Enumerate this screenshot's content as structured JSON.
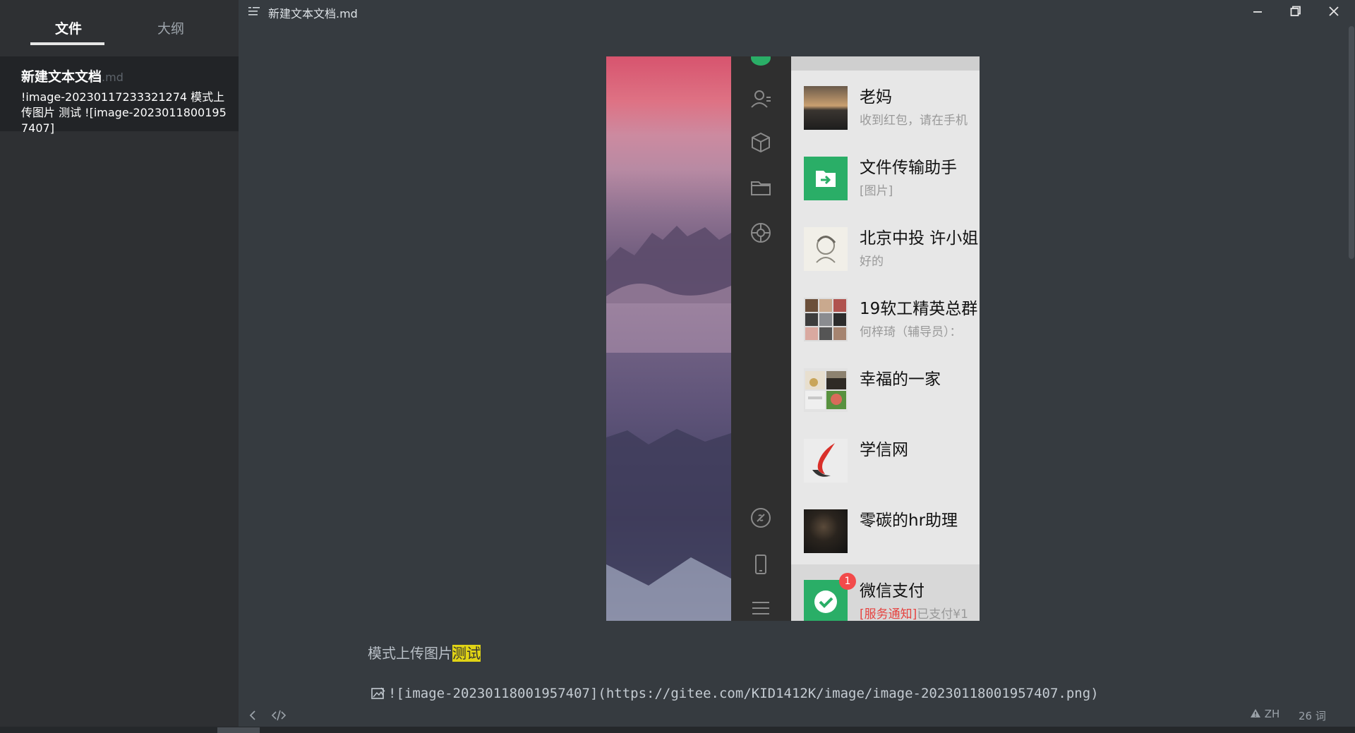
{
  "sidebar": {
    "tabs": [
      {
        "label": "文件",
        "active": true
      },
      {
        "label": "大纲",
        "active": false
      }
    ],
    "files": [
      {
        "name": "新建文本文档",
        "ext": ".md",
        "preview": "!image-20230117233321274 模式上传图片 测试 ![image-20230118001957407]"
      }
    ]
  },
  "titlebar": {
    "title": "新建文本文档.md",
    "icons": [
      "menu-icon",
      "minimize-icon",
      "maximize-icon",
      "close-icon"
    ]
  },
  "editor": {
    "embedded_image": {
      "nav_icons": [
        "chat-icon",
        "contacts-icon",
        "box-icon",
        "folder-icon",
        "moments-icon",
        "link-icon",
        "phone-icon",
        "menu-icon"
      ],
      "chats": [
        {
          "name": "老妈",
          "message": "收到红包，请在手机",
          "avatar": "sunset"
        },
        {
          "name": "文件传输助手",
          "message": "[图片]",
          "avatar": "file-transfer"
        },
        {
          "name": "北京中投 许小姐",
          "message": "好的",
          "avatar": "sketch"
        },
        {
          "name": "19软工精英总群",
          "message": "何梓琦（辅导员）：",
          "avatar": "group-grid"
        },
        {
          "name": "幸福的一家",
          "message": "",
          "avatar": "family-grid"
        },
        {
          "name": "学信网",
          "message": "",
          "avatar": "xuexin-logo"
        },
        {
          "name": "零碳的hr助理",
          "message": "",
          "avatar": "photo-dark"
        },
        {
          "name": "微信支付",
          "message_prefix": "[服务通知]",
          "message": "已支付¥1",
          "badge": "1",
          "avatar": "wechat-pay"
        }
      ]
    },
    "paragraph_text": "模式上传图片",
    "paragraph_highlight": "测试",
    "code_line": "![image-20230118001957407](https://gitee.com/KID1412K/image/image-20230118001957407.png)"
  },
  "statusbar": {
    "language": "ZH",
    "word_count": "26 词"
  },
  "colors": {
    "background": "#363b40",
    "sidebar": "#2e3033",
    "highlight": "#e0d315",
    "wechat_green": "#2aae67"
  }
}
